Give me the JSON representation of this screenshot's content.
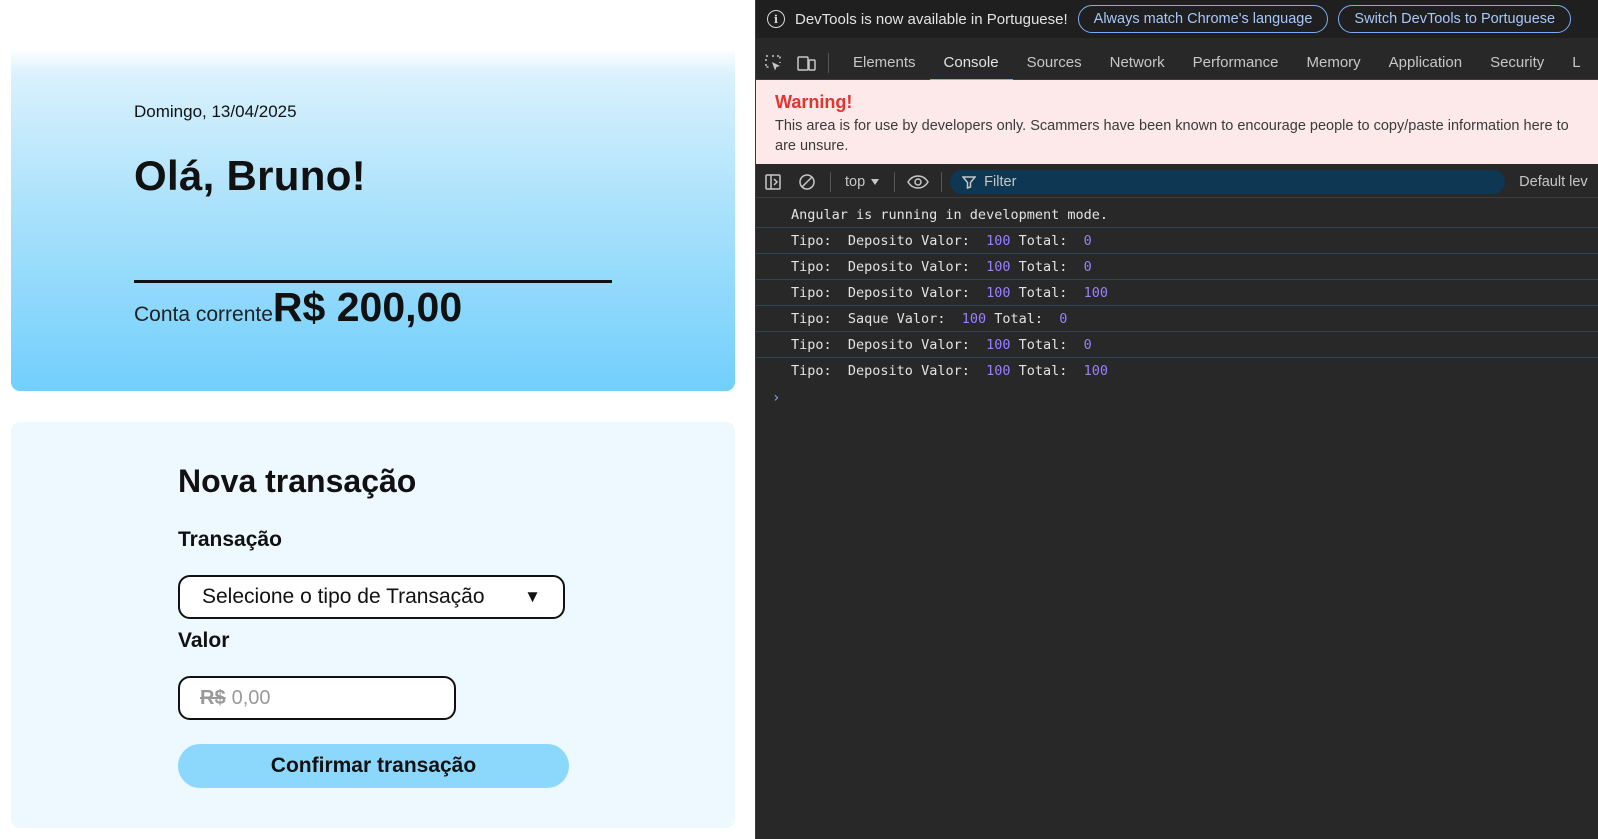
{
  "app": {
    "date": "Domingo, 13/04/2025",
    "greeting": "Olá, Bruno!",
    "account_label": "Conta corrente",
    "account_value": "R$ 200,00",
    "transaction": {
      "title": "Nova transação",
      "type_label": "Transação",
      "type_selected": "Selecione o tipo de Transação",
      "type_arrow": "▼",
      "value_label": "Valor",
      "currency_prefix": "R$",
      "value_placeholder": "0,00",
      "confirm_label": "Confirmar transação"
    }
  },
  "devtools": {
    "infobar": {
      "message": "DevTools is now available in Portuguese!",
      "btn_match": "Always match Chrome's language",
      "btn_switch": "Switch DevTools to Portuguese"
    },
    "tabs": [
      {
        "label": "Elements"
      },
      {
        "label": "Console"
      },
      {
        "label": "Sources"
      },
      {
        "label": "Network"
      },
      {
        "label": "Performance"
      },
      {
        "label": "Memory"
      },
      {
        "label": "Application"
      },
      {
        "label": "Security"
      },
      {
        "label": "L"
      }
    ],
    "active_tab": "Console",
    "warning": {
      "title": "Warning!",
      "line1": "This area is for use by developers only. Scammers have been known to encourage people to copy/paste information here to",
      "line2": "are unsure."
    },
    "console_toolbar": {
      "context": "top",
      "filter_placeholder": "Filter",
      "levels": "Default lev"
    },
    "logs": [
      {
        "text": "Angular is running in development mode."
      },
      {
        "tipo_label": "Tipo:  ",
        "tipo": "Deposito",
        "valor_label": " Valor:  ",
        "valor": "100",
        "total_label": " Total:  ",
        "total": "0"
      },
      {
        "tipo_label": "Tipo:  ",
        "tipo": "Deposito",
        "valor_label": " Valor:  ",
        "valor": "100",
        "total_label": " Total:  ",
        "total": "0"
      },
      {
        "tipo_label": "Tipo:  ",
        "tipo": "Deposito",
        "valor_label": " Valor:  ",
        "valor": "100",
        "total_label": " Total:  ",
        "total": "100"
      },
      {
        "tipo_label": "Tipo:  ",
        "tipo": "Saque",
        "valor_label": " Valor:  ",
        "valor": "100",
        "total_label": " Total:  ",
        "total": "0"
      },
      {
        "tipo_label": "Tipo:  ",
        "tipo": "Deposito",
        "valor_label": " Valor:  ",
        "valor": "100",
        "total_label": " Total:  ",
        "total": "0"
      },
      {
        "tipo_label": "Tipo:  ",
        "tipo": "Deposito",
        "valor_label": " Valor:  ",
        "valor": "100",
        "total_label": " Total:  ",
        "total": "100"
      }
    ],
    "prompt_glyph": "›",
    "colors": {
      "accent": "#7cacf8",
      "number": "#9980ff",
      "warning_title": "#e3342f",
      "balance_gradient_end": "#72cffc",
      "confirm_button": "#8cd8fc"
    }
  }
}
